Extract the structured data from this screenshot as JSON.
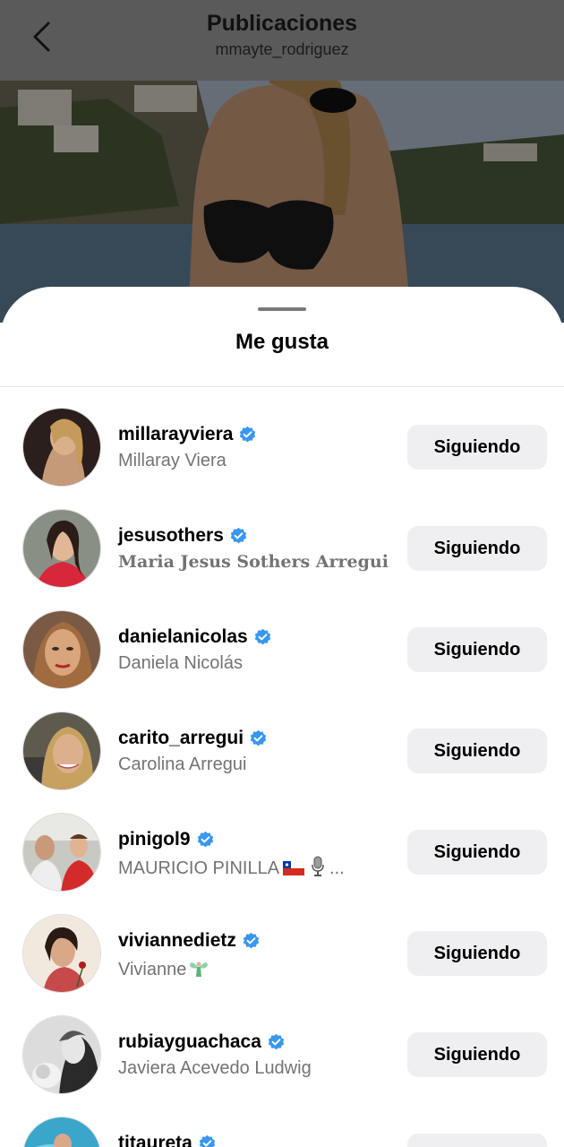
{
  "header": {
    "title": "Publicaciones",
    "subtitle": "mmayte_rodriguez",
    "back_icon": "chevron-left-icon"
  },
  "sheet": {
    "title": "Me gusta"
  },
  "colors": {
    "verified_badge": "#3897f0",
    "button_bg": "#efeff1",
    "secondary_text": "#737373"
  },
  "likers": [
    {
      "username": "millarayviera",
      "name": "Millaray Viera",
      "verified": true,
      "button": "Siguiendo"
    },
    {
      "username": "jesusothers",
      "name": "Maria Jesus Sothers Arregui",
      "verified": true,
      "button": "Siguiendo"
    },
    {
      "username": "danielanicolas",
      "name": "Daniela Nicolás",
      "verified": true,
      "button": "Siguiendo"
    },
    {
      "username": "carito_arregui",
      "name": "Carolina Arregui",
      "verified": true,
      "button": "Siguiendo"
    },
    {
      "username": "pinigol9",
      "name": "MAURICIO PINILLA",
      "name_suffix": "...",
      "name_icons": [
        "chile-flag-icon",
        "microphone-icon"
      ],
      "verified": true,
      "button": "Siguiendo"
    },
    {
      "username": "viviannedietz",
      "name": "Vivianne",
      "name_icons": [
        "fairy-icon"
      ],
      "verified": true,
      "button": "Siguiendo"
    },
    {
      "username": "rubiayguachaca",
      "name": "Javiera Acevedo Ludwig",
      "verified": true,
      "button": "Siguiendo"
    },
    {
      "username": "titaureta",
      "name": "",
      "verified": true,
      "button": "Siguiendo"
    }
  ]
}
